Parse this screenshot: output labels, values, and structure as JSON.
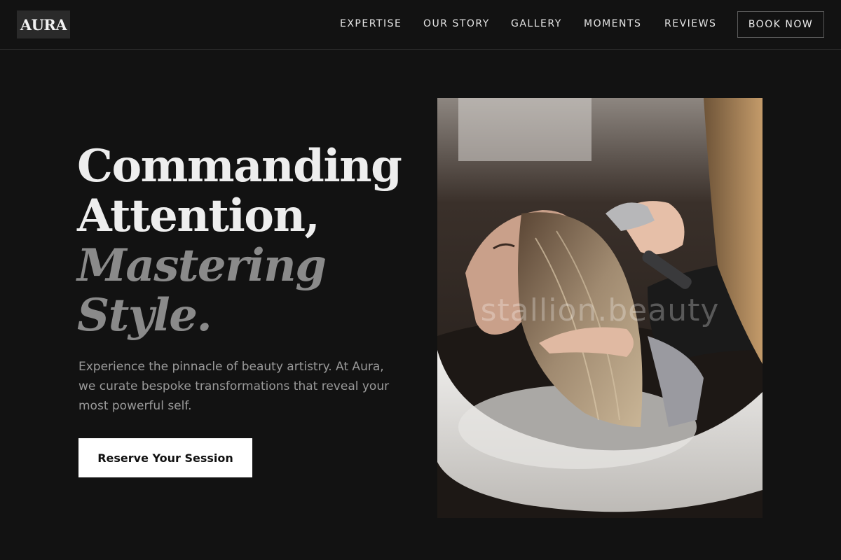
{
  "brand": {
    "logo_text": "AURA"
  },
  "nav": {
    "items": [
      "EXPERTISE",
      "OUR STORY",
      "GALLERY",
      "MOMENTS",
      "REVIEWS"
    ],
    "book_label": "BOOK NOW"
  },
  "hero": {
    "headline_line1": "Commanding",
    "headline_line2": "Attention,",
    "headline_line3": "Mastering",
    "headline_line4": "Style.",
    "description": "Experience the pinnacle of beauty artistry. At Aura, we curate bespoke transformations that reveal your most powerful self.",
    "cta_label": "Reserve Your Session"
  },
  "photo": {
    "watermark": "stallion.beauty",
    "subject": "hair-wash-salon-photo"
  },
  "colors": {
    "background": "#121212",
    "accent_light": "#ffffff",
    "muted_text": "#8a8a8a"
  }
}
